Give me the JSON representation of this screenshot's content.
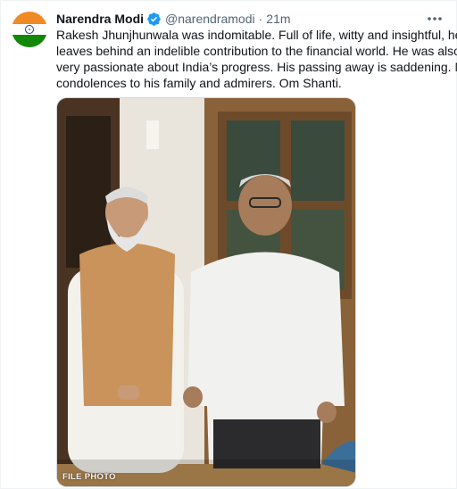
{
  "tweet": {
    "author": {
      "display_name": "Narendra Modi",
      "handle": "@narendramodi",
      "verified": true,
      "avatar": "indian-flag-avatar"
    },
    "separator": "·",
    "timestamp": "21m",
    "more_icon": "more-horizontal-icon",
    "text_lines": [
      "Rakesh Jhunjhunwala was indomitable. Full of life, witty and insightful, he",
      "leaves behind an indelible contribution to the financial world. He was also",
      "very passionate about India’s progress. His passing away is saddening. My",
      "condolences to his family and admirers. Om Shanti."
    ],
    "media": {
      "watermark": "FILE PHOTO"
    }
  },
  "colors": {
    "saffron": "#f08a24",
    "green": "#138808",
    "verified_blue": "#1d9bf0",
    "secondary_text": "#536471"
  }
}
